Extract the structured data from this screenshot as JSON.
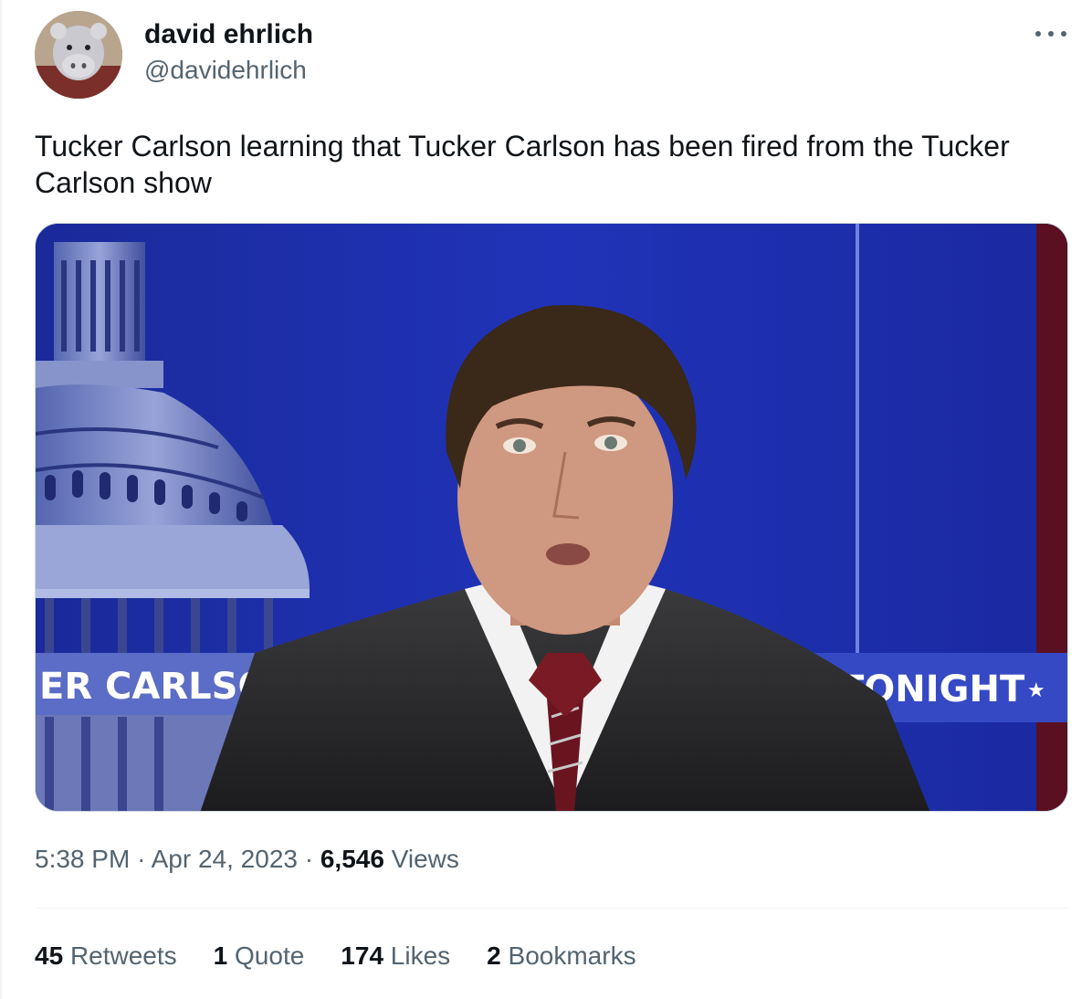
{
  "tweet": {
    "author": {
      "name": "david ehrlich",
      "handle": "@davidehrlich"
    },
    "text": "Tucker Carlson learning that Tucker Carlson has been fired from the Tucker Carlson show",
    "media": {
      "banner_left": "ER CARLSON",
      "banner_right": "TONIGHT",
      "banner_star": "★"
    },
    "meta": {
      "time": "5:38 PM",
      "sep1": "·",
      "date": "Apr 24, 2023",
      "sep2": "·",
      "views_count": "6,546",
      "views_label": "Views"
    },
    "stats": {
      "retweets": {
        "count": "45",
        "label": "Retweets"
      },
      "quotes": {
        "count": "1",
        "label": "Quote"
      },
      "likes": {
        "count": "174",
        "label": "Likes"
      },
      "bookmarks": {
        "count": "2",
        "label": "Bookmarks"
      }
    }
  },
  "colors": {
    "text_primary": "#0f1419",
    "text_secondary": "#536471",
    "border": "#eff3f4",
    "studio_blue": "#1c2aa8"
  },
  "icons": [
    "more-icon"
  ]
}
